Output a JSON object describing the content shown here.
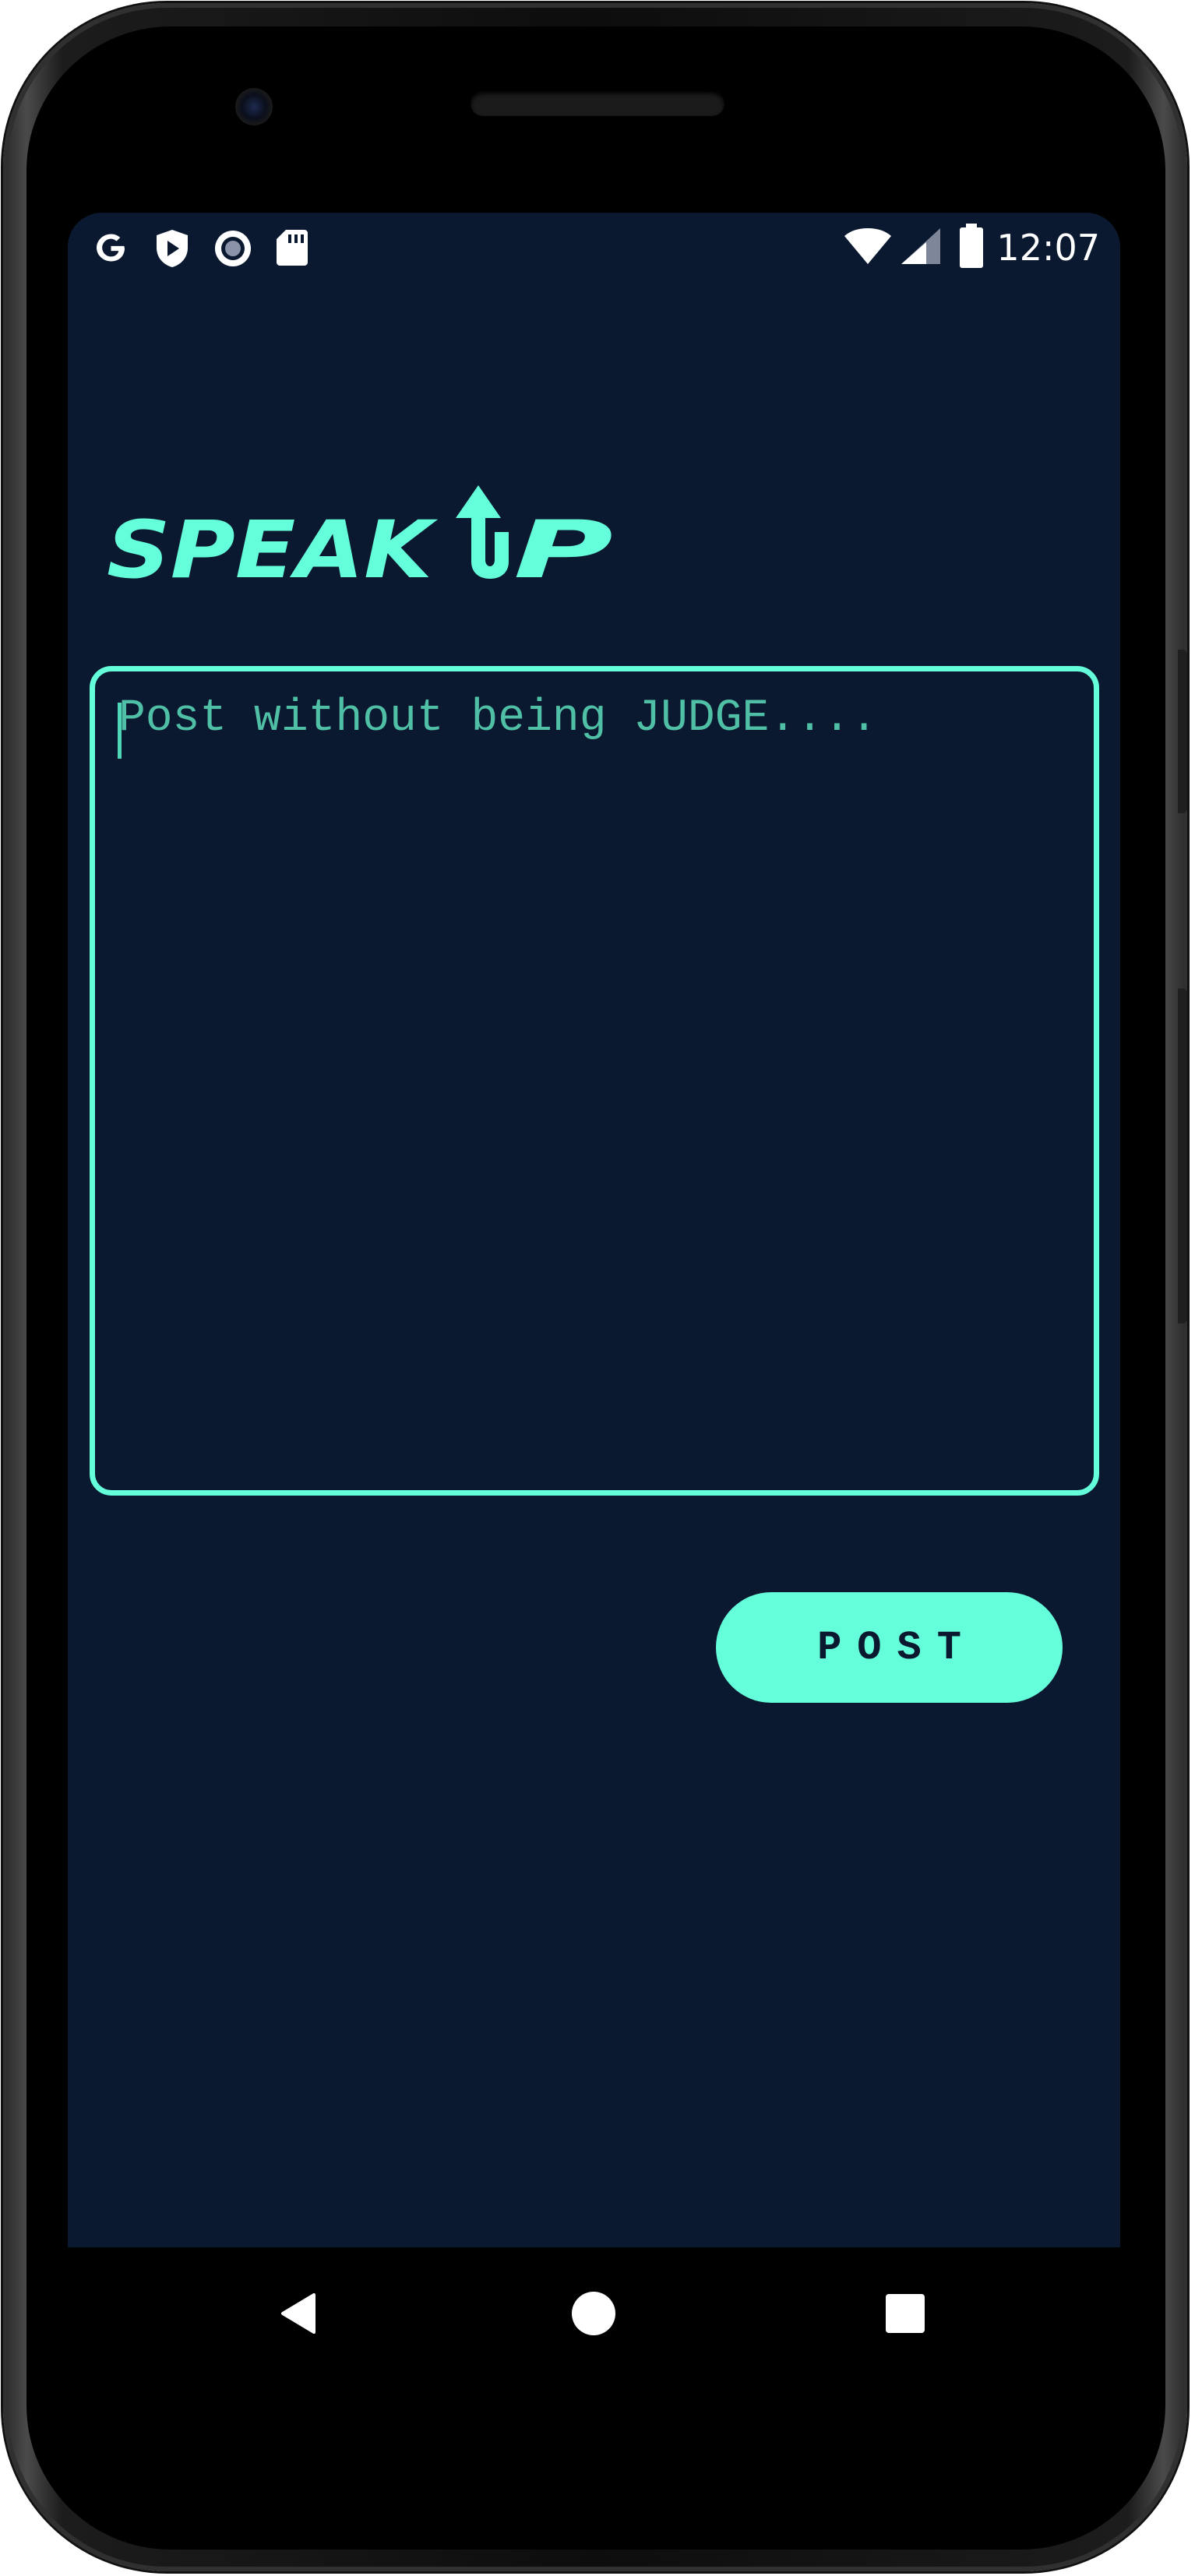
{
  "status_bar": {
    "time": "12:07",
    "left_icons": [
      "google-icon",
      "shield-play-icon",
      "record-icon",
      "sd-card-icon"
    ],
    "right_icons": [
      "wifi-icon",
      "cellular-signal-icon",
      "battery-icon"
    ]
  },
  "app": {
    "logo_text": "SPEAK UP"
  },
  "composer": {
    "placeholder": "Post without being JUDGE....",
    "value": ""
  },
  "actions": {
    "post_label": "POST"
  },
  "nav": {
    "items": [
      "back-icon",
      "home-icon",
      "recents-icon"
    ]
  },
  "colors": {
    "background": "#0b1930",
    "accent": "#64ffda",
    "placeholder": "#4fbfa6"
  }
}
